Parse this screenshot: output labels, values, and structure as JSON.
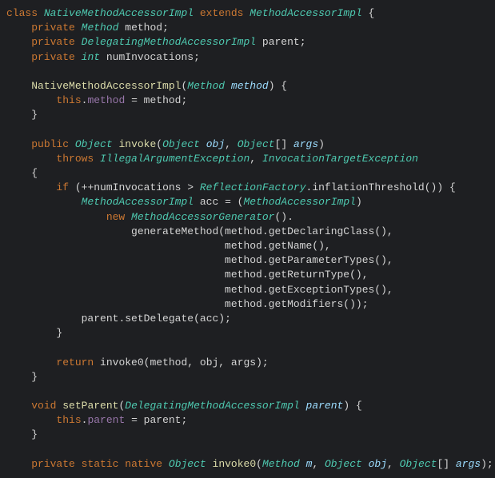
{
  "code": {
    "l1": {
      "kw_class": "class",
      "cls1": "NativeMethodAccessorImpl",
      "kw_ext": "extends",
      "cls2": "MethodAccessorImpl",
      "brace": "{"
    },
    "l2": {
      "kw": "private",
      "type": "Method",
      "name": "method;"
    },
    "l3": {
      "kw": "private",
      "type": "DelegatingMethodAccessorImpl",
      "name": "parent;"
    },
    "l4": {
      "kw": "private",
      "type": "int",
      "name": "numInvocations;"
    },
    "l5": {
      "ctor": "NativeMethodAccessorImpl",
      "lp": "(",
      "ptype": "Method",
      "pname": "method",
      "rp": ") {"
    },
    "l6": {
      "kw": "this",
      "dot": ".",
      "field": "method",
      "eq": " = ",
      "rhs": "method;"
    },
    "l7": {
      "brace": "}"
    },
    "l8": {
      "kw1": "public",
      "type": "Object",
      "name": "invoke",
      "args_open": "(",
      "ptype1": "Object",
      "pname1": "obj",
      "comma": ", ",
      "ptype2": "Object",
      "arr": "[] ",
      "pname2": "args",
      "close": ")"
    },
    "l9": {
      "kw": "throws",
      "ex1": "IllegalArgumentException",
      "comma": ", ",
      "ex2": "InvocationTargetException"
    },
    "l10": {
      "brace": "{"
    },
    "l11": {
      "kw": "if",
      "open": " (",
      "op": "++",
      "var": "numInvocations",
      "gt": " > ",
      "cls": "ReflectionFactory",
      "dot": ".",
      "call": "inflationThreshold",
      "end": "()) {"
    },
    "l12": {
      "type": "MethodAccessorImpl",
      "var": "acc",
      "eq": " = (",
      "cast": "MethodAccessorImpl",
      "close": ")"
    },
    "l13": {
      "kw": "new",
      "cls": "MethodAccessorGenerator",
      "end": "()."
    },
    "l14": {
      "call": "generateMethod",
      "open": "(",
      "obj": "method",
      "dot": ".",
      "m": "getDeclaringClass",
      "end": "(),"
    },
    "l15": {
      "obj": "method",
      "dot": ".",
      "m": "getName",
      "end": "(),"
    },
    "l16": {
      "obj": "method",
      "dot": ".",
      "m": "getParameterTypes",
      "end": "(),"
    },
    "l17": {
      "obj": "method",
      "dot": ".",
      "m": "getReturnType",
      "end": "(),"
    },
    "l18": {
      "obj": "method",
      "dot": ".",
      "m": "getExceptionTypes",
      "end": "(),"
    },
    "l19": {
      "obj": "method",
      "dot": ".",
      "m": "getModifiers",
      "end": "());"
    },
    "l20": {
      "obj": "parent",
      "dot": ".",
      "m": "setDelegate",
      "open": "(",
      "arg": "acc",
      "end": ");"
    },
    "l21": {
      "brace": "}"
    },
    "l22": {
      "kw": "return",
      "sp": " ",
      "call": "invoke0",
      "open": "(",
      "a1": "method",
      "c1": ", ",
      "a2": "obj",
      "c2": ", ",
      "a3": "args",
      "end": ");"
    },
    "l23": {
      "brace": "}"
    },
    "l24": {
      "kw": "void",
      "name": "setParent",
      "open": "(",
      "ptype": "DelegatingMethodAccessorImpl",
      "pname": "parent",
      "end": ") {"
    },
    "l25": {
      "kw": "this",
      "dot": ".",
      "field": "parent",
      "eq": " = ",
      "rhs": "parent;"
    },
    "l26": {
      "brace": "}"
    },
    "l27": {
      "kw1": "private",
      "kw2": "static",
      "kw3": "native",
      "type": "Object",
      "name": "invoke0",
      "open": "(",
      "pt1": "Method",
      "pn1": "m",
      "c1": ", ",
      "pt2": "Object",
      "pn2": "obj",
      "c2": ", ",
      "pt3": "Object",
      "arr": "[] ",
      "pn3": "args",
      "end": ");"
    }
  }
}
